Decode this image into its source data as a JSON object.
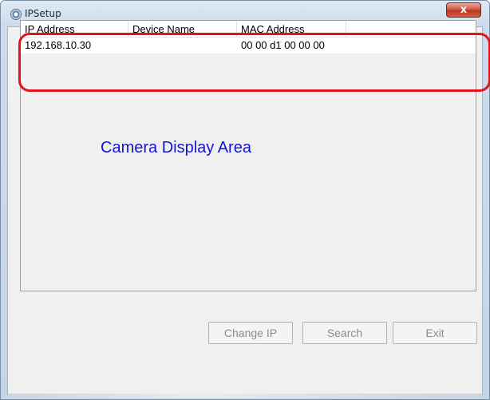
{
  "window": {
    "title": "IPSetup",
    "close_glyph": "x"
  },
  "device_list": {
    "columns": [
      "IP Address",
      "Device Name",
      "MAC Address",
      ""
    ],
    "rows": [
      {
        "ip": "192.168.10.30",
        "name": "",
        "mac": "00 00 d1 00 00 00"
      }
    ]
  },
  "annotation": {
    "camera_area_label": "Camera Display Area",
    "highlight_color": "#e3131b",
    "label_color": "#1414d6"
  },
  "buttons": {
    "change_ip": "Change IP",
    "search": "Search",
    "exit": "Exit"
  },
  "icons": {
    "app": "ipsetup-app-icon",
    "close": "close-icon"
  }
}
